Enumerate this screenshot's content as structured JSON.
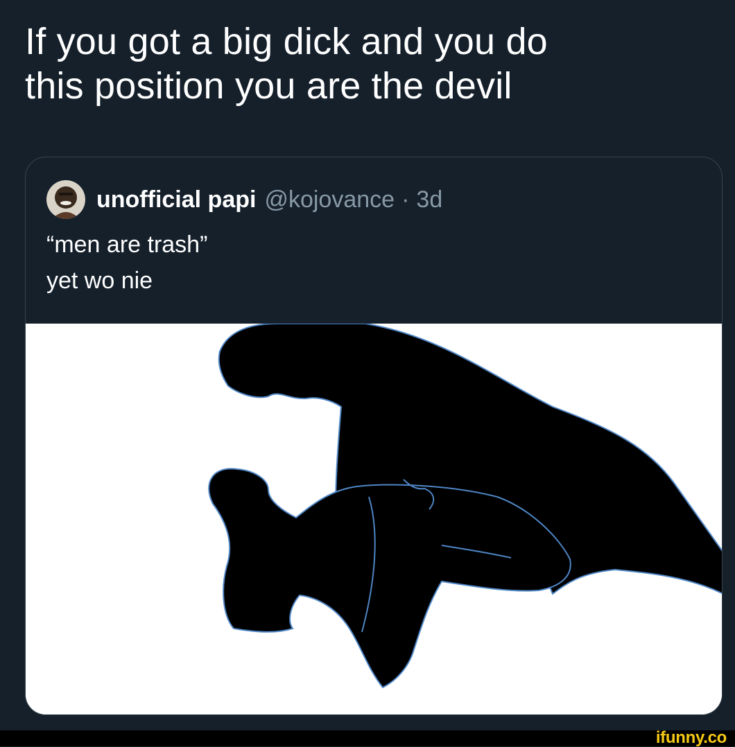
{
  "post": {
    "text_line1": "If you got a big dick and you do",
    "text_line2": "this position you are the devil"
  },
  "quoted_tweet": {
    "display_name": "unofficial papi",
    "handle": "@kojovance",
    "separator": "·",
    "timestamp": "3d",
    "text_line1": "“men are trash”",
    "text_line2": "yet wo nie"
  },
  "watermark": "ifunny.co",
  "colors": {
    "background": "#15202b",
    "card_border": "#38444d",
    "secondary_text": "#8899a6",
    "watermark": "#f6c915",
    "silhouette": "#000000",
    "outline_glow": "#4f86c6"
  },
  "icons": {
    "avatar": "profile-photo",
    "media": "silhouette-illustration"
  }
}
